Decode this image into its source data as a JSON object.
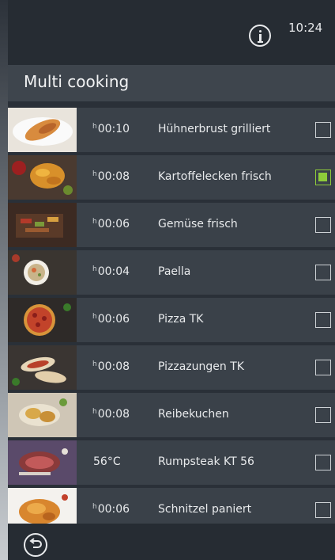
{
  "header": {
    "clock": "10:24",
    "info_icon": "info-icon"
  },
  "page": {
    "title": "Multi cooking"
  },
  "colors": {
    "accent": "#8ecb3a",
    "row_bg": "#3a4149",
    "title_bar": "#3e454d"
  },
  "programs": [
    {
      "time": "00:10",
      "hours_prefix": "h",
      "name": "Hühnerbrust grilliert",
      "checked": false
    },
    {
      "time": "00:08",
      "hours_prefix": "h",
      "name": "Kartoffelecken frisch",
      "checked": true
    },
    {
      "time": "00:06",
      "hours_prefix": "h",
      "name": "Gemüse frisch",
      "checked": false
    },
    {
      "time": "00:04",
      "hours_prefix": "h",
      "name": "Paella",
      "checked": false
    },
    {
      "time": "00:06",
      "hours_prefix": "h",
      "name": "Pizza TK",
      "checked": false
    },
    {
      "time": "00:08",
      "hours_prefix": "h",
      "name": "Pizzazungen TK",
      "checked": false
    },
    {
      "time": "00:08",
      "hours_prefix": "h",
      "name": "Reibekuchen",
      "checked": false
    },
    {
      "time": "56°C",
      "hours_prefix": "",
      "name": "Rumpsteak KT 56",
      "checked": false
    },
    {
      "time": "00:06",
      "hours_prefix": "h",
      "name": "Schnitzel paniert",
      "checked": false
    }
  ],
  "footer": {
    "back_icon": "back-icon"
  }
}
